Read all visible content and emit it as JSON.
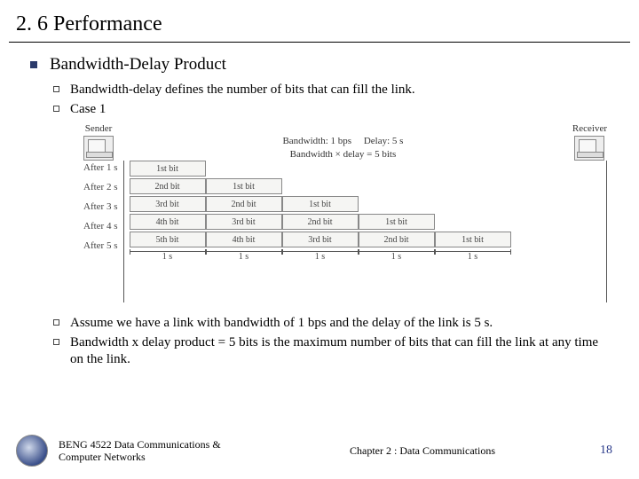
{
  "title": "2. 6 Performance",
  "main_bullet": "Bandwidth-Delay Product",
  "sub1": "Bandwidth-delay defines the number of bits that can fill the link.",
  "sub2": "Case 1",
  "figure": {
    "sender": "Sender",
    "receiver": "Receiver",
    "bandwidth": "Bandwidth: 1 bps",
    "delay": "Delay: 5 s",
    "product": "Bandwidth × delay = 5 bits",
    "row_labels": [
      "After 1 s",
      "After 2 s",
      "After 3 s",
      "After 4 s",
      "After 5 s"
    ],
    "rows": [
      [
        "1st bit"
      ],
      [
        "2nd bit",
        "1st bit"
      ],
      [
        "3rd bit",
        "2nd bit",
        "1st bit"
      ],
      [
        "4th bit",
        "3rd bit",
        "2nd bit",
        "1st bit"
      ],
      [
        "5th bit",
        "4th bit",
        "3rd bit",
        "2nd bit",
        "1st bit"
      ]
    ],
    "axis_label": "1 s"
  },
  "sub3": "Assume we have a link with bandwidth of 1 bps and the delay of the link is 5 s.",
  "sub4": "Bandwidth x delay product = 5 bits is the maximum number of bits that can fill the link at any time on the link.",
  "footer": {
    "course": "BENG 4522 Data Communications & Computer Networks",
    "chapter": "Chapter 2 : Data Communications",
    "page": "18"
  }
}
